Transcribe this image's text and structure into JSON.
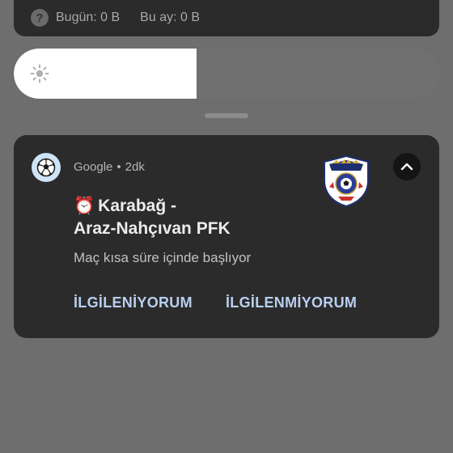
{
  "data_usage": {
    "help_icon": "help-icon",
    "today": "Bugün: 0 B",
    "this_month": "Bu ay: 0 B"
  },
  "brightness": {
    "icon": "sun-icon",
    "level": 0.43
  },
  "notification": {
    "app_icon": "soccer-ball-icon",
    "app_name": "Google",
    "separator": "•",
    "time": "2dk",
    "title_emoji": "⏰",
    "title_line1": "Karabağ -",
    "title_line2": "Araz-Nahçıvan PFK",
    "body": "Maç kısa süre içinde başlıyor",
    "large_icon": "team-logo",
    "collapse_icon": "chevron-up-icon",
    "actions": [
      {
        "label": "İLGİLENİYORUM"
      },
      {
        "label": "İLGİLENMİYORUM"
      }
    ],
    "accent_color": "#b8cff0"
  }
}
